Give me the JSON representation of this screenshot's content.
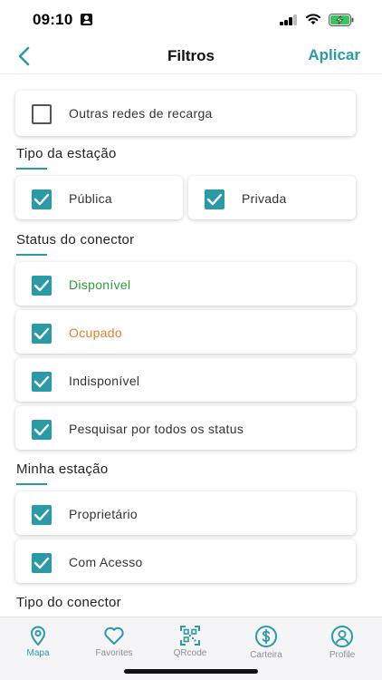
{
  "status_bar": {
    "time": "09:10"
  },
  "header": {
    "title": "Filtros",
    "apply_label": "Aplicar"
  },
  "top_option": {
    "label": "Outras redes de recarga",
    "checked": false
  },
  "sections": {
    "station_type": {
      "title": "Tipo da estação",
      "options": [
        {
          "label": "Pública",
          "checked": true
        },
        {
          "label": "Privada",
          "checked": true
        }
      ]
    },
    "connector_status": {
      "title": "Status do conector",
      "options": [
        {
          "label": "Disponível",
          "checked": true,
          "color": "#2a9d3a"
        },
        {
          "label": "Ocupado",
          "checked": true,
          "color": "#e67c2b"
        },
        {
          "label": "Indisponível",
          "checked": true,
          "color": "#333333"
        },
        {
          "label": "Pesquisar por todos os status",
          "checked": true,
          "color": "#333333"
        }
      ]
    },
    "my_station": {
      "title": "Minha estação",
      "options": [
        {
          "label": "Proprietário",
          "checked": true
        },
        {
          "label": "Com Acesso",
          "checked": true
        }
      ]
    },
    "connector_type": {
      "title": "Tipo do conector"
    }
  },
  "tab_bar": {
    "tabs": [
      {
        "label": "Mapa",
        "icon": "map-pin-icon",
        "active": true
      },
      {
        "label": "Favorites",
        "icon": "heart-icon",
        "active": false
      },
      {
        "label": "QRcode",
        "icon": "qrcode-icon",
        "active": false
      },
      {
        "label": "Carteira",
        "icon": "dollar-icon",
        "active": false
      },
      {
        "label": "Profile",
        "icon": "profile-icon",
        "active": false
      }
    ]
  },
  "colors": {
    "accent": "#2a9aa6",
    "available": "#2a9d3a",
    "occupied": "#e67c2b",
    "inactive_tab": "#8a8f93"
  }
}
